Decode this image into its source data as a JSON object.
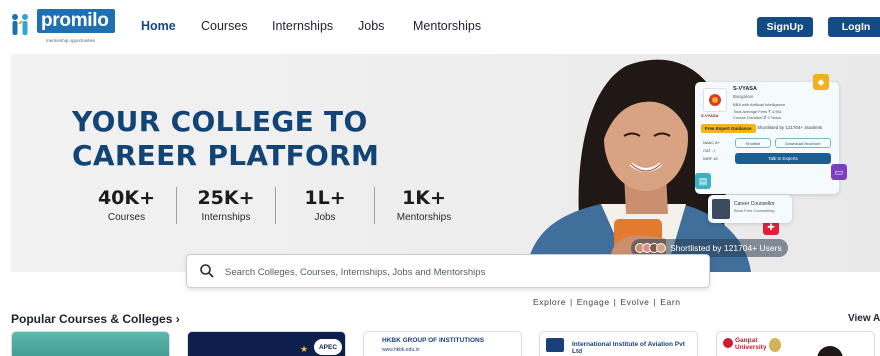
{
  "brand": {
    "logo_text": "promilo",
    "tagline": "mentorship opportunities"
  },
  "nav": {
    "links": [
      "Home",
      "Courses",
      "Internships",
      "Jobs",
      "Mentorships"
    ],
    "active": "Home",
    "signup_label": "SignUp",
    "login_label": "LogIn"
  },
  "hero": {
    "title": "YOUR COLLEGE TO CAREER PLATFORM",
    "stats": [
      {
        "value": "40K+",
        "label": "Courses"
      },
      {
        "value": "25K+",
        "label": "Internships"
      },
      {
        "value": "1L+",
        "label": "Jobs"
      },
      {
        "value": "1K+",
        "label": "Mentorships"
      }
    ],
    "college_card": {
      "name": "S-VYASA",
      "location": "Bangalore",
      "logo_text": "S-VYASA",
      "course": "BBA with Artificial Intelligence",
      "rows": [
        "Total Average Fees      ₹ 4.96L",
        "Course Duration           ⏱ 2 Years"
      ],
      "expert_badge": "Free Expert Guidance",
      "shortlisted": "Shortlisted by 121704+ Students",
      "shortlist_button": "Shortlist",
      "brochure_button": "Download Brochure",
      "talk_button": "Talk to Experts",
      "meta": [
        "NAAC A+",
        "CAT - I",
        "NIRF #2"
      ]
    },
    "counselor_card": {
      "title": "Career Counsellor",
      "subtitle": "Book Free Counselling"
    },
    "shortlisted_pill": "Shortlisted by 121704+ Users",
    "colors": {
      "title": "#134476",
      "yellow_square": "#f2b01e",
      "purple_square": "#7b3fc1",
      "teal_square": "#3bb3c3",
      "red_square": "#e0203a"
    }
  },
  "search": {
    "placeholder": "Search Colleges, Courses, Internships, Jobs and Mentorships"
  },
  "tagline": "Explore  |  Engage  |  Evolve  |  Earn",
  "popular": {
    "title": "Popular Courses & Colleges",
    "view_all": "View All",
    "cards": [
      {
        "text": ""
      },
      {
        "text": "APEC"
      },
      {
        "text": "HKBK GROUP OF INSTITUTIONS",
        "sub": "www.hkbk.edu.in"
      },
      {
        "text": "International Institute of Aviation Pvt Ltd",
        "sub": ""
      },
      {
        "text": "Ganpat University",
        "sub": ""
      }
    ]
  }
}
